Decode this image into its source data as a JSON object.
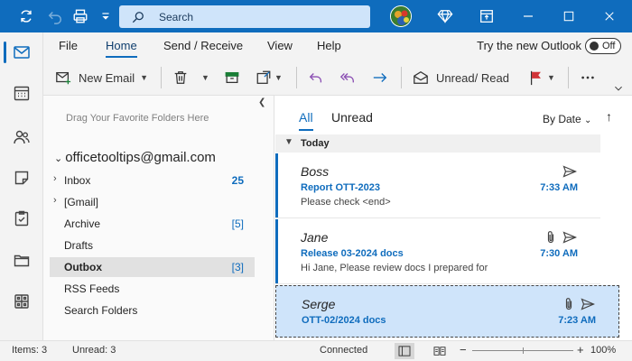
{
  "titlebar": {
    "search_placeholder": "Search",
    "window_controls": [
      "minimize",
      "restore",
      "close"
    ]
  },
  "ribbon": {
    "tabs": [
      "File",
      "Home",
      "Send / Receive",
      "View",
      "Help"
    ],
    "active_tab": "Home",
    "try_new_label": "Try the new Outlook",
    "toggle_label": "Off",
    "new_email_label": "New Email",
    "unread_read_label": "Unread/ Read"
  },
  "folders": {
    "drag_hint": "Drag Your Favorite Folders Here",
    "account": "officetooltips@gmail.com",
    "items": [
      {
        "name": "Inbox",
        "count": "25",
        "bold_count": true,
        "expandable": true
      },
      {
        "name": "[Gmail]",
        "count": "",
        "bold_count": false,
        "expandable": true
      },
      {
        "name": "Archive",
        "count": "[5]",
        "bold_count": false,
        "expandable": false
      },
      {
        "name": "Drafts",
        "count": "",
        "bold_count": false,
        "expandable": false
      },
      {
        "name": "Outbox",
        "count": "[3]",
        "bold_count": false,
        "expandable": false,
        "selected": true
      },
      {
        "name": "RSS Feeds",
        "count": "",
        "bold_count": false,
        "expandable": false
      },
      {
        "name": "Search Folders",
        "count": "",
        "bold_count": false,
        "expandable": false
      }
    ]
  },
  "list": {
    "tab_all": "All",
    "tab_unread": "Unread",
    "sort_label": "By Date",
    "group_label": "Today",
    "messages": [
      {
        "sender": "Boss",
        "subject": "Report OTT-2023",
        "preview": "Please check <end>",
        "time": "7:33 AM",
        "attachment": false
      },
      {
        "sender": "Jane",
        "subject": "Release 03-2024 docs",
        "preview": "Hi Jane,  Please review docs I prepared for",
        "time": "7:30 AM",
        "attachment": true
      },
      {
        "sender": "Serge",
        "subject": "OTT-02/2024 docs",
        "preview": "",
        "time": "7:23 AM",
        "attachment": true
      }
    ]
  },
  "status": {
    "items": "Items: 3",
    "unread": "Unread: 3",
    "connection": "Connected",
    "zoom": "100%"
  },
  "colors": {
    "accent": "#0f6cbd",
    "selected_bg": "#cfe4fa",
    "titlebar": "#0f6cbd"
  }
}
